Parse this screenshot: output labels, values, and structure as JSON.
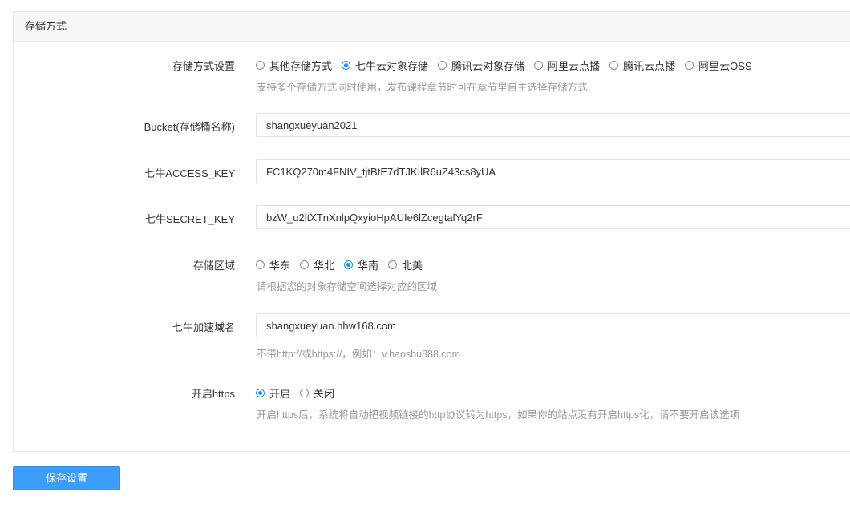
{
  "panel": {
    "title": "存储方式"
  },
  "storage_method": {
    "label": "存储方式设置",
    "options": [
      "其他存储方式",
      "七牛云对象存储",
      "腾讯云对象存储",
      "阿里云点播",
      "腾讯云点播",
      "阿里云OSS"
    ],
    "selected": "七牛云对象存储",
    "help": "支持多个存储方式同时使用，发布课程章节时可在章节里自主选择存储方式"
  },
  "bucket": {
    "label": "Bucket(存储桶名称)",
    "value": "shangxueyuan2021"
  },
  "access_key": {
    "label": "七牛ACCESS_KEY",
    "value": "FC1KQ270m4FNIV_tjtBtE7dTJKIlR6uZ43cs8yUA"
  },
  "secret_key": {
    "label": "七牛SECRET_KEY",
    "value": "bzW_u2ltXTnXnlpQxyioHpAUIe6lZcegtalYq2rF"
  },
  "region": {
    "label": "存储区域",
    "options": [
      "华东",
      "华北",
      "华南",
      "北美"
    ],
    "selected": "华南",
    "help": "请根据您的对象存储空间选择对应的区域"
  },
  "domain": {
    "label": "七牛加速域名",
    "value": "shangxueyuan.hhw168.com",
    "help": "不带http://或https://，例如：v.haoshu888.com"
  },
  "https": {
    "label": "开启https",
    "options": [
      "开启",
      "关闭"
    ],
    "selected": "开启",
    "help": "开启https后，系统将自动把视频链接的http协议转为https，如果你的站点没有开启https化，请不要开启该选项"
  },
  "save_button": {
    "label": "保存设置"
  },
  "colors": {
    "accent": "#1890ff",
    "button": "#3d9dfb",
    "help_text": "#999999"
  }
}
